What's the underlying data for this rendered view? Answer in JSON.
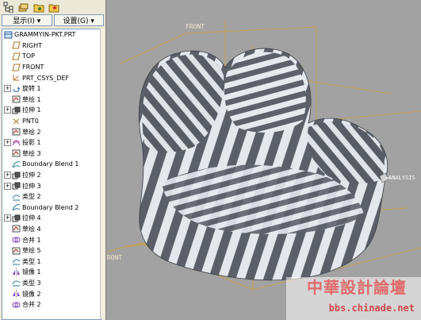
{
  "toolbar": {
    "icons": [
      "model-tree-icon",
      "layers-icon",
      "folder-icon",
      "favorites-icon"
    ]
  },
  "menus": {
    "show_label": "显示(I) ▾",
    "settings_label": "设置(G) ▾"
  },
  "tree": {
    "root": "GRAMMYIN-PKT.PRT",
    "items": [
      {
        "label": "RIGHT",
        "icon": "datum-plane-icon",
        "expand": ""
      },
      {
        "label": "TOP",
        "icon": "datum-plane-icon",
        "expand": ""
      },
      {
        "label": "FRONT",
        "icon": "datum-plane-icon",
        "expand": ""
      },
      {
        "label": "PRT_CSYS_DEF",
        "icon": "csys-icon",
        "expand": ""
      },
      {
        "label": "旋转 1",
        "icon": "revolve-icon",
        "expand": "+"
      },
      {
        "label": "草绘 1",
        "icon": "sketch-icon",
        "expand": ""
      },
      {
        "label": "拉伸 1",
        "icon": "extrude-icon",
        "expand": "+"
      },
      {
        "label": "PNT0",
        "icon": "datum-point-icon",
        "expand": ""
      },
      {
        "label": "草绘 2",
        "icon": "sketch-icon",
        "expand": ""
      },
      {
        "label": "投影 1",
        "icon": "projection-icon",
        "expand": "+"
      },
      {
        "label": "草绘 3",
        "icon": "sketch-icon",
        "expand": ""
      },
      {
        "label": "Boundary Blend 1",
        "icon": "boundary-blend-icon",
        "expand": ""
      },
      {
        "label": "拉伸 2",
        "icon": "extrude-icon",
        "expand": "+"
      },
      {
        "label": "拉伸 3",
        "icon": "extrude-icon",
        "expand": "+"
      },
      {
        "label": "类型 2",
        "icon": "style-icon",
        "expand": ""
      },
      {
        "label": "Boundary Blend 2",
        "icon": "boundary-blend-icon",
        "expand": ""
      },
      {
        "label": "拉伸 4",
        "icon": "extrude-icon",
        "expand": "+"
      },
      {
        "label": "草绘 4",
        "icon": "sketch-icon",
        "expand": ""
      },
      {
        "label": "合并 1",
        "icon": "merge-icon",
        "expand": ""
      },
      {
        "label": "草绘 5",
        "icon": "sketch-icon",
        "expand": ""
      },
      {
        "label": "类型 1",
        "icon": "style-icon",
        "expand": ""
      },
      {
        "label": "镜像 1",
        "icon": "mirror-icon",
        "expand": ""
      },
      {
        "label": "类型 3",
        "icon": "style-icon",
        "expand": ""
      },
      {
        "label": "镜像 2",
        "icon": "mirror-icon",
        "expand": ""
      },
      {
        "label": "合并 2",
        "icon": "merge-icon",
        "expand": ""
      }
    ]
  },
  "viewport": {
    "datum_front_top": "FRONT",
    "datum_front_bottom": "FRONT",
    "analysis_label": "ANALYSIS",
    "watermark_cn": "中華設計論壇",
    "watermark_url": "bbs.chinade.net"
  },
  "colors": {
    "datum": "#c8a050",
    "surface_dark": "#5b6068",
    "surface_light": "#e4e7ec",
    "background": "#a2a2a2"
  }
}
